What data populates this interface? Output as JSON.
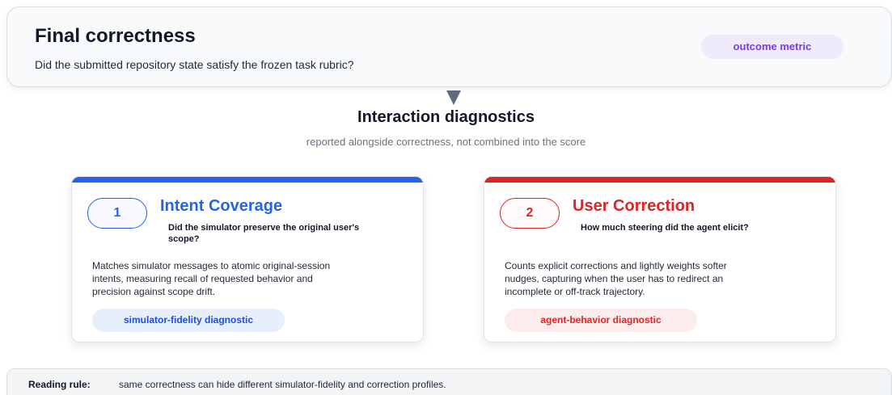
{
  "top": {
    "title": "Final correctness",
    "question": "Did the submitted repository state satisfy the frozen task rubric?",
    "badge": "outcome metric"
  },
  "diagnostics": {
    "heading": "Interaction diagnostics",
    "subheading": "reported alongside correctness, not combined into the score"
  },
  "cards": [
    {
      "number": "1",
      "title": "Intent Coverage",
      "question": "Did the simulator preserve the original user's scope?",
      "description": "Matches simulator messages to atomic original-session intents, measuring recall of requested behavior and precision against scope drift.",
      "tag": "simulator-fidelity diagnostic",
      "color": "#2563eb"
    },
    {
      "number": "2",
      "title": "User Correction",
      "question": "How much steering did the agent elicit?",
      "description": "Counts explicit corrections and lightly weights softer nudges, capturing when the user has to redirect an incomplete or off-track trajectory.",
      "tag": "agent-behavior diagnostic",
      "color": "#dc2626"
    }
  ],
  "reading_rule": {
    "label": "Reading rule:",
    "text": "same correctness can hide different simulator-fidelity and correction profiles."
  },
  "colors": {
    "outcome_accent": "#7c3aed",
    "arrow": "#5f6b7a"
  }
}
